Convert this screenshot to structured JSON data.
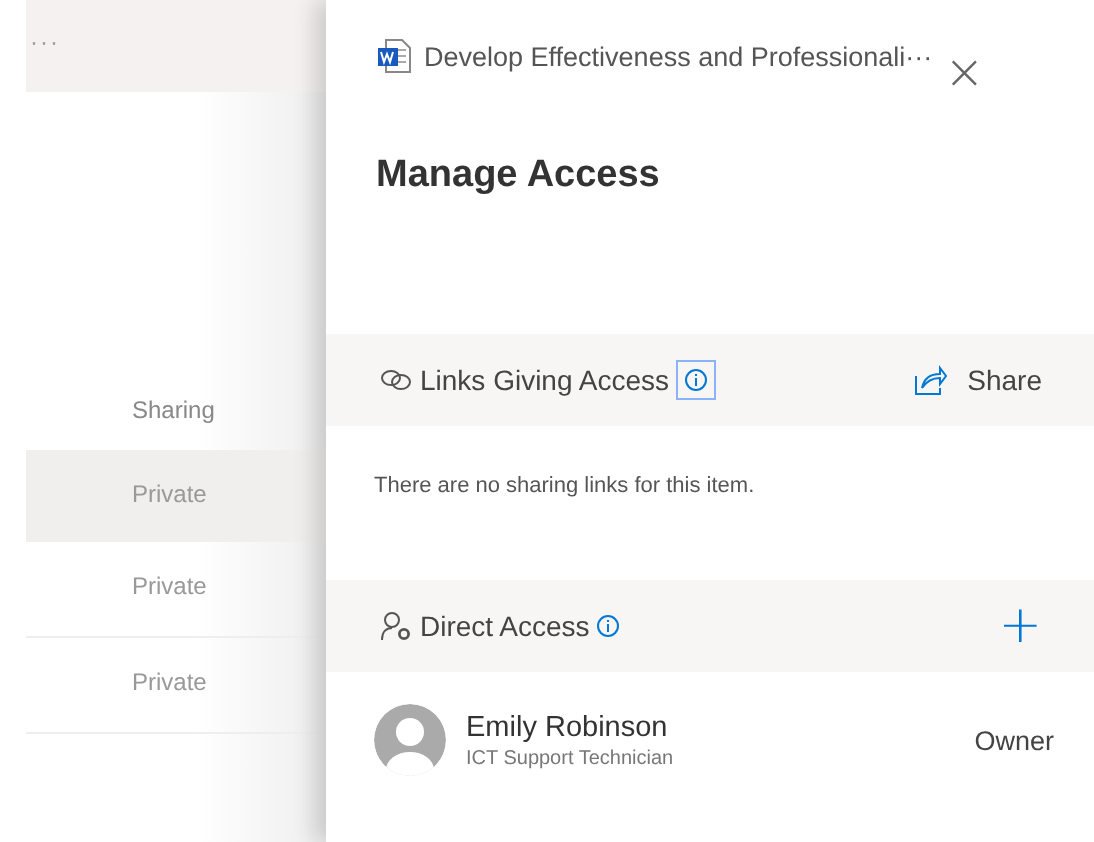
{
  "list": {
    "menu": "···",
    "column_header": "Sharing",
    "rows": [
      {
        "text": "Private",
        "selected": true
      },
      {
        "text": "Private",
        "selected": false
      },
      {
        "text": "Private",
        "selected": false
      }
    ]
  },
  "panel": {
    "file_title": "Develop Effectiveness and Professionali···",
    "close": "×",
    "heading": "Manage Access",
    "links_section": {
      "title": "Links Giving Access",
      "action": "Share",
      "empty_message": "There are no sharing links for this item."
    },
    "direct_section": {
      "title": "Direct Access",
      "add": "+"
    },
    "people": [
      {
        "name": "Emily Robinson",
        "role": "ICT Support Technician",
        "permission": "Owner"
      }
    ]
  }
}
